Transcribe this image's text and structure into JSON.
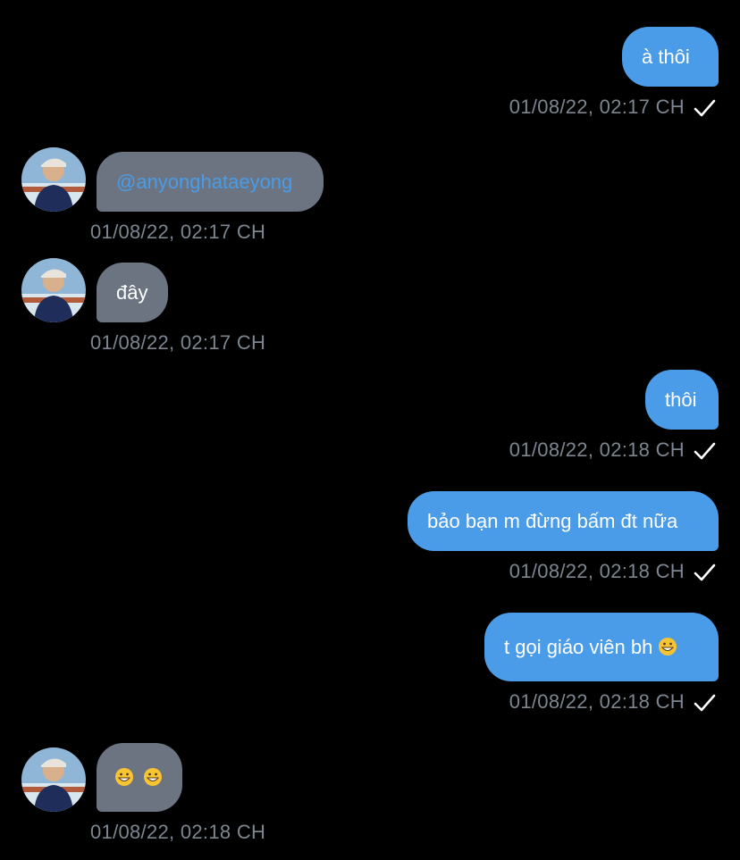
{
  "messages": [
    {
      "side": "sent",
      "text": "à thôi",
      "time": "01/08/22, 02:17 CH"
    },
    {
      "side": "recv",
      "text": "@anyonghataeyong",
      "time": "01/08/22, 02:17 CH",
      "mention": true
    },
    {
      "side": "recv",
      "text": "đây",
      "time": "01/08/22, 02:17 CH"
    },
    {
      "side": "sent",
      "text": "thôi",
      "time": "01/08/22, 02:18 CH"
    },
    {
      "side": "sent",
      "text": "bảo bạn m đừng bấm đt nữa",
      "time": "01/08/22, 02:18 CH"
    },
    {
      "side": "sent",
      "text": "t gọi giáo viên bh",
      "time": "01/08/22, 02:18 CH",
      "emoji": "grinning-face"
    },
    {
      "side": "recv",
      "text": "",
      "time": "01/08/22, 02:18 CH",
      "emoji": "grinning-face x2"
    }
  ],
  "colors": {
    "sent_bubble": "#4a9ce8",
    "recv_bubble": "#6b7480",
    "timestamp": "#7d8690",
    "mention": "#4a9ce8"
  }
}
